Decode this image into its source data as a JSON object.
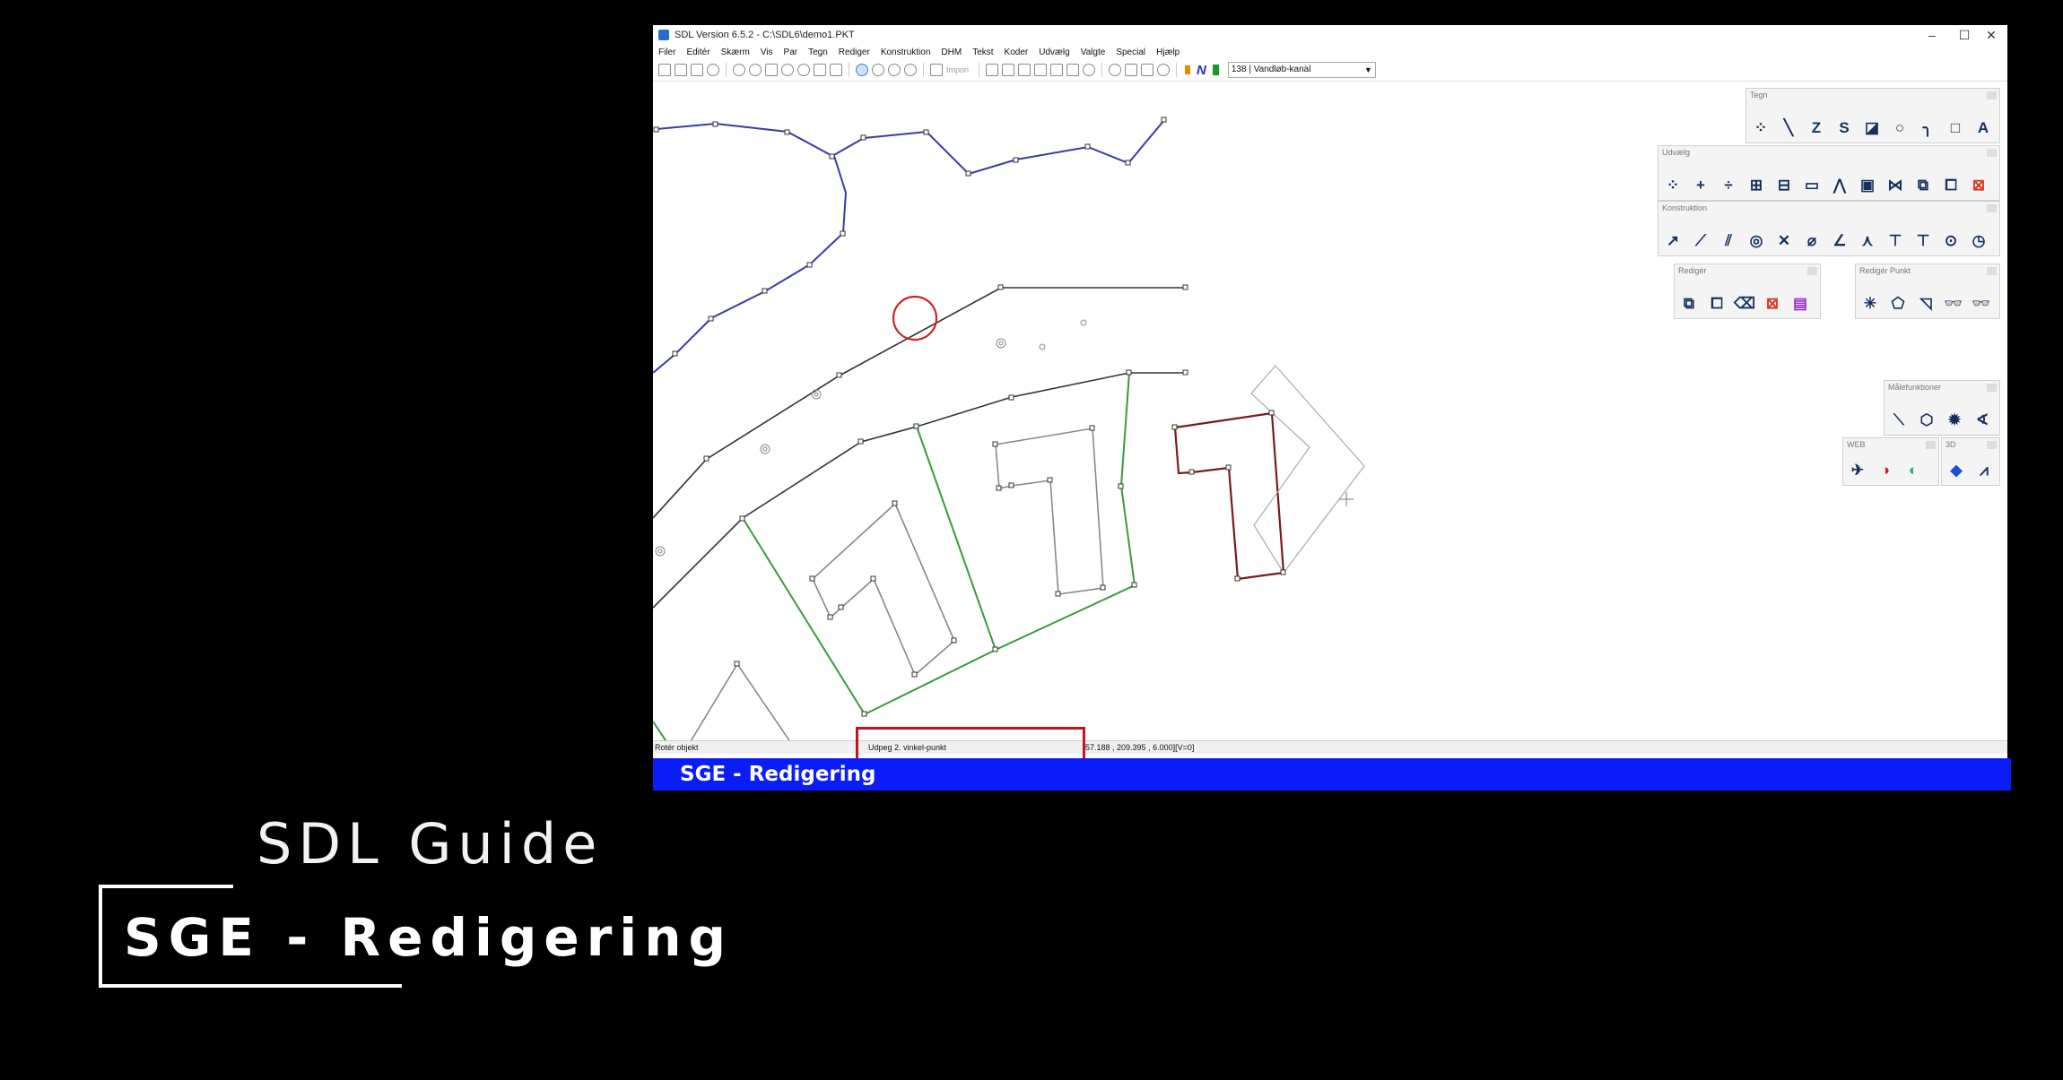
{
  "window": {
    "title": "SDL Version 6.5.2 - C:\\SDL6\\demo1.PKT",
    "controls": [
      "–",
      "☐",
      "✕"
    ]
  },
  "menu": [
    "Filer",
    "Editér",
    "Skærm",
    "Vis",
    "Par",
    "Tegn",
    "Rediger",
    "Konstruktion",
    "DHM",
    "Tekst",
    "Koder",
    "Udvælg",
    "Valgte",
    "Special",
    "Hjælp"
  ],
  "toolbar": {
    "layer_select": "138 | Vandløb-kanal",
    "import_label": "Impon"
  },
  "palettes": {
    "tegn": "Tegn",
    "udvaelg": "Udvælg",
    "konstruktion": "Konstruktion",
    "rediger": "Redigér",
    "rediger_punkt": "Redigér Punkt",
    "maalefunktioner": "Målefunktioner",
    "web": "WEB",
    "3d": "3D"
  },
  "status": {
    "left": "Rotér objekt",
    "prompt": "Udpeg 2. vinkel-punkt",
    "coords": "57.188 , 209.395 , 6.000][V=0]"
  },
  "caption": "SGE - Redigering",
  "guide_title": "SDL Guide",
  "guide_subtitle": "SGE - Redigering",
  "colors": {
    "caption_bar": "#0b1df6",
    "highlight": "#c4141a",
    "watercourse": "#3a3aa8",
    "boundary": "#3a9a3a",
    "road": "#333333",
    "building": "#888888",
    "selected": "#7a1a1a"
  }
}
